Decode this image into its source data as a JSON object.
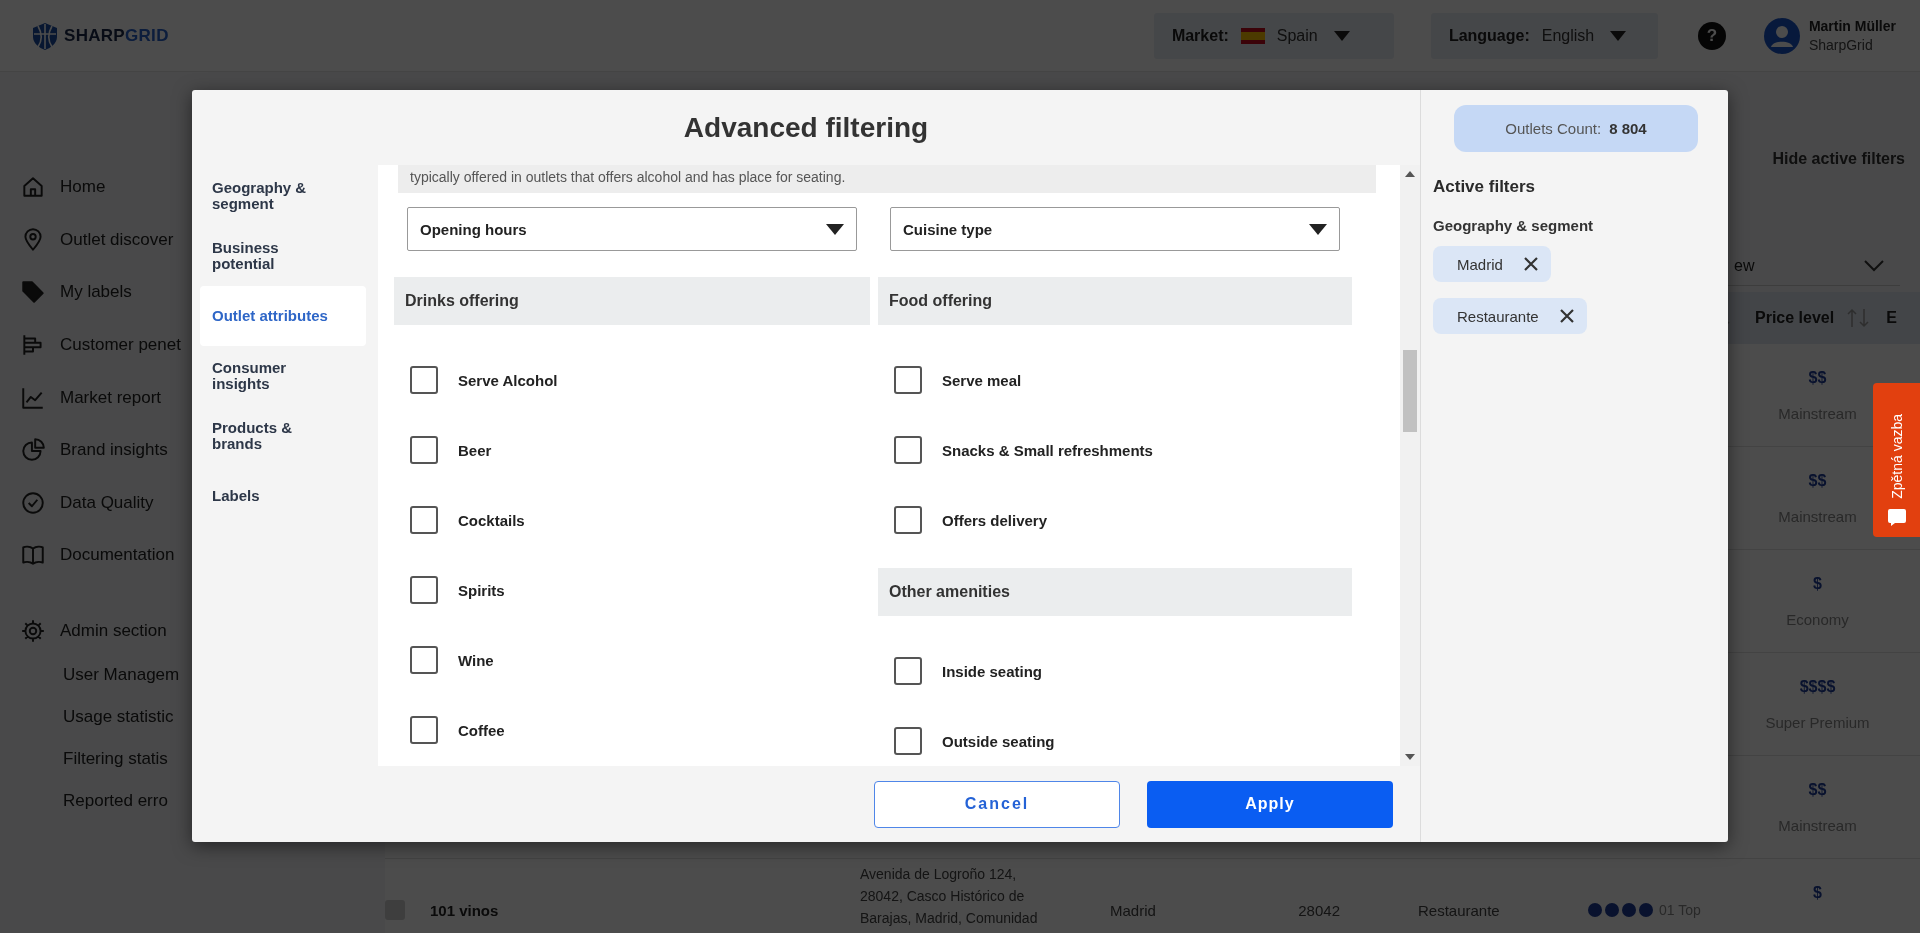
{
  "header": {
    "logo_parts": [
      "SHARP",
      "GRID"
    ],
    "market": {
      "label": "Market:",
      "value": "Spain"
    },
    "language": {
      "label": "Language:",
      "value": "English"
    },
    "help": "?",
    "user": {
      "name": "Martin Müller",
      "organization": "SharpGrid"
    }
  },
  "sidebar": {
    "items": [
      {
        "label": "Home"
      },
      {
        "label": "Outlet discover"
      },
      {
        "label": "My labels"
      },
      {
        "label": "Customer penet"
      },
      {
        "label": "Market report"
      },
      {
        "label": "Brand insights"
      },
      {
        "label": "Data Quality"
      },
      {
        "label": "Documentation"
      }
    ],
    "admin": {
      "label": "Admin section",
      "children": [
        "User Managem",
        "Usage statistic",
        "Filtering statis",
        "Reported erro"
      ]
    }
  },
  "main": {
    "hide_filters": "Hide active filters",
    "view_select": "ew",
    "table": {
      "header": {
        "price": "Price level",
        "column_9": "E"
      },
      "rows": [
        {
          "price": "$$",
          "tier": "Mainstream"
        },
        {
          "price": "$$",
          "tier": "Mainstream"
        },
        {
          "price": "$",
          "tier": "Economy"
        },
        {
          "price": "$$$$",
          "tier": "Super Premium"
        },
        {
          "price": "$$",
          "tier": "Mainstream"
        },
        {
          "checked": false,
          "name": "101 vinos",
          "address": "Avenida de Logroño 124, 28042, Casco Histórico de Barajas, Madrid, Comunidad",
          "city": "Madrid",
          "zip": "28042",
          "type": "Restaurante",
          "stars": 4,
          "rating_label": "01 Top",
          "price": "$"
        }
      ]
    }
  },
  "feedback": {
    "label": "Zpětná vazba"
  },
  "modal": {
    "title": "Advanced filtering",
    "nav": [
      {
        "label": "Geography & segment",
        "selected": false
      },
      {
        "label": "Business potential",
        "selected": false
      },
      {
        "label": "Outlet attributes",
        "selected": true
      },
      {
        "label": "Consumer insights",
        "selected": false
      },
      {
        "label": "Products & brands",
        "selected": false
      },
      {
        "label": "Labels",
        "selected": false
      }
    ],
    "description": "typically offered in outlets that offers alcohol and has place for seating.",
    "dropdowns": [
      {
        "label": "Opening hours"
      },
      {
        "label": "Cuisine type"
      }
    ],
    "columns": [
      {
        "sections": [
          {
            "title": "Drinks offering",
            "options": [
              {
                "label": "Serve Alcohol",
                "checked": false
              },
              {
                "label": "Beer",
                "checked": false
              },
              {
                "label": "Cocktails",
                "checked": false
              },
              {
                "label": "Spirits",
                "checked": false
              },
              {
                "label": "Wine",
                "checked": false
              },
              {
                "label": "Coffee",
                "checked": false
              }
            ]
          }
        ]
      },
      {
        "sections": [
          {
            "title": "Food offering",
            "options": [
              {
                "label": "Serve meal",
                "checked": false
              },
              {
                "label": "Snacks & Small refreshments",
                "checked": false
              },
              {
                "label": "Offers delivery",
                "checked": false
              }
            ]
          },
          {
            "title": "Other amenities",
            "options": [
              {
                "label": "Inside seating",
                "checked": false
              },
              {
                "label": "Outside seating",
                "checked": false
              }
            ]
          }
        ]
      }
    ],
    "buttons": {
      "cancel": "Cancel",
      "apply": "Apply"
    },
    "side": {
      "count_label": "Outlets Count:",
      "count": "8 804",
      "active_title": "Active filters",
      "groups": [
        {
          "title": "Geography & segment",
          "chips": [
            "Madrid",
            "Restaurante"
          ]
        }
      ]
    }
  }
}
